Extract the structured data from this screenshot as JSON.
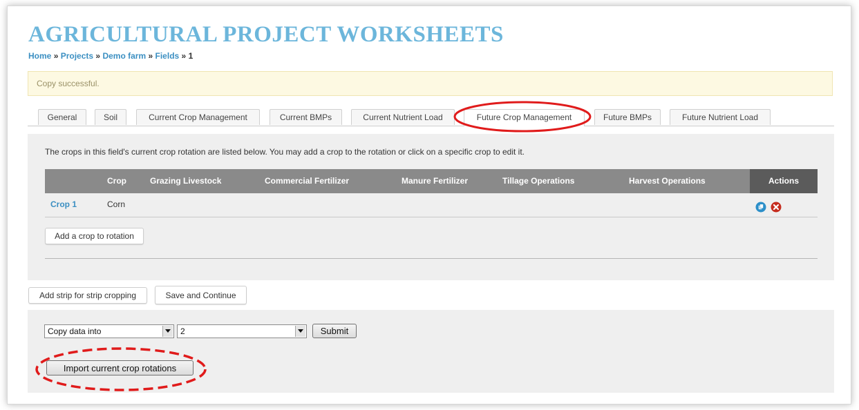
{
  "header": {
    "title": "AGRICULTURAL PROJECT WORKSHEETS",
    "breadcrumb": {
      "home": "Home",
      "projects": "Projects",
      "farm": "Demo farm",
      "fields": "Fields",
      "current": "1",
      "separator": "»"
    }
  },
  "notice": {
    "text": "Copy successful."
  },
  "tabs": [
    {
      "label": "General"
    },
    {
      "label": "Soil"
    },
    {
      "label": "Current Crop Management"
    },
    {
      "label": "Current BMPs"
    },
    {
      "label": "Current Nutrient Load"
    },
    {
      "label": "Future Crop Management",
      "active": true
    },
    {
      "label": "Future BMPs"
    },
    {
      "label": "Future Nutrient Load"
    }
  ],
  "panel": {
    "intro": "The crops in this field's current crop rotation are listed below. You may add a crop to the rotation or click on a specific crop to edit it.",
    "table": {
      "headers": {
        "crop": "Crop",
        "grazing": "Grazing Livestock",
        "commercial": "Commercial Fertilizer",
        "manure": "Manure Fertilizer",
        "tillage": "Tillage Operations",
        "harvest": "Harvest Operations",
        "actions": "Actions"
      },
      "rows": [
        {
          "name": "Crop 1",
          "crop": "Corn",
          "copy_icon": "copy-icon",
          "delete_icon": "delete-icon"
        }
      ]
    },
    "add_crop_label": "Add a crop to rotation"
  },
  "actions": {
    "add_strip_label": "Add strip for strip cropping",
    "save_label": "Save and Continue"
  },
  "copy_panel": {
    "action_select_value": "Copy data into",
    "target_select_value": "2",
    "submit_label": "Submit",
    "import_label": "Import current crop rotations"
  },
  "colors": {
    "title": "#6cb6db",
    "link": "#3b8fc2",
    "table_header": "#8a8a8a",
    "actions_header": "#5b5b5b",
    "notice_bg": "#fdf9e2",
    "annotation": "#e01b1b",
    "copy_icon": "#2c8fc9",
    "delete_icon": "#c62d1f"
  }
}
